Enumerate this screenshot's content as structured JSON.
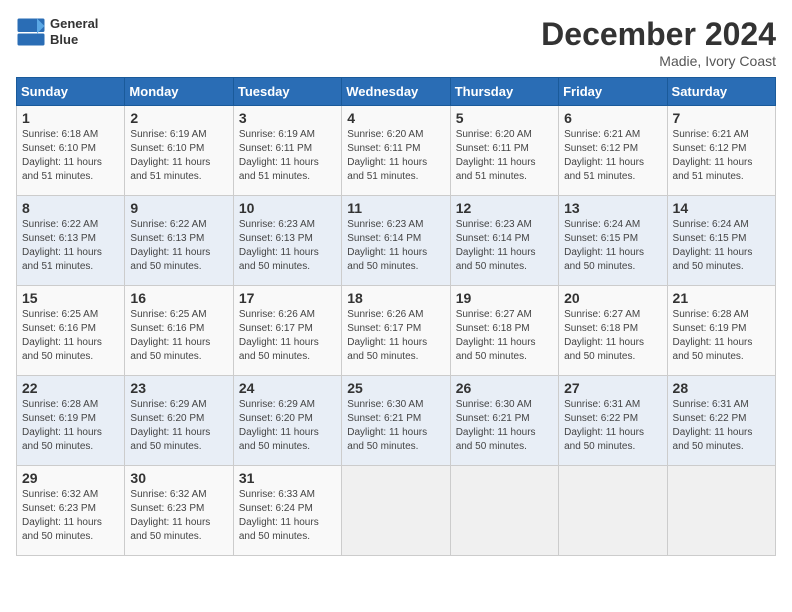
{
  "logo": {
    "line1": "General",
    "line2": "Blue"
  },
  "title": "December 2024",
  "subtitle": "Madie, Ivory Coast",
  "weekdays": [
    "Sunday",
    "Monday",
    "Tuesday",
    "Wednesday",
    "Thursday",
    "Friday",
    "Saturday"
  ],
  "weeks": [
    [
      {
        "day": "1",
        "sunrise": "6:18 AM",
        "sunset": "6:10 PM",
        "daylight": "11 hours and 51 minutes."
      },
      {
        "day": "2",
        "sunrise": "6:19 AM",
        "sunset": "6:10 PM",
        "daylight": "11 hours and 51 minutes."
      },
      {
        "day": "3",
        "sunrise": "6:19 AM",
        "sunset": "6:11 PM",
        "daylight": "11 hours and 51 minutes."
      },
      {
        "day": "4",
        "sunrise": "6:20 AM",
        "sunset": "6:11 PM",
        "daylight": "11 hours and 51 minutes."
      },
      {
        "day": "5",
        "sunrise": "6:20 AM",
        "sunset": "6:11 PM",
        "daylight": "11 hours and 51 minutes."
      },
      {
        "day": "6",
        "sunrise": "6:21 AM",
        "sunset": "6:12 PM",
        "daylight": "11 hours and 51 minutes."
      },
      {
        "day": "7",
        "sunrise": "6:21 AM",
        "sunset": "6:12 PM",
        "daylight": "11 hours and 51 minutes."
      }
    ],
    [
      {
        "day": "8",
        "sunrise": "6:22 AM",
        "sunset": "6:13 PM",
        "daylight": "11 hours and 51 minutes."
      },
      {
        "day": "9",
        "sunrise": "6:22 AM",
        "sunset": "6:13 PM",
        "daylight": "11 hours and 50 minutes."
      },
      {
        "day": "10",
        "sunrise": "6:23 AM",
        "sunset": "6:13 PM",
        "daylight": "11 hours and 50 minutes."
      },
      {
        "day": "11",
        "sunrise": "6:23 AM",
        "sunset": "6:14 PM",
        "daylight": "11 hours and 50 minutes."
      },
      {
        "day": "12",
        "sunrise": "6:23 AM",
        "sunset": "6:14 PM",
        "daylight": "11 hours and 50 minutes."
      },
      {
        "day": "13",
        "sunrise": "6:24 AM",
        "sunset": "6:15 PM",
        "daylight": "11 hours and 50 minutes."
      },
      {
        "day": "14",
        "sunrise": "6:24 AM",
        "sunset": "6:15 PM",
        "daylight": "11 hours and 50 minutes."
      }
    ],
    [
      {
        "day": "15",
        "sunrise": "6:25 AM",
        "sunset": "6:16 PM",
        "daylight": "11 hours and 50 minutes."
      },
      {
        "day": "16",
        "sunrise": "6:25 AM",
        "sunset": "6:16 PM",
        "daylight": "11 hours and 50 minutes."
      },
      {
        "day": "17",
        "sunrise": "6:26 AM",
        "sunset": "6:17 PM",
        "daylight": "11 hours and 50 minutes."
      },
      {
        "day": "18",
        "sunrise": "6:26 AM",
        "sunset": "6:17 PM",
        "daylight": "11 hours and 50 minutes."
      },
      {
        "day": "19",
        "sunrise": "6:27 AM",
        "sunset": "6:18 PM",
        "daylight": "11 hours and 50 minutes."
      },
      {
        "day": "20",
        "sunrise": "6:27 AM",
        "sunset": "6:18 PM",
        "daylight": "11 hours and 50 minutes."
      },
      {
        "day": "21",
        "sunrise": "6:28 AM",
        "sunset": "6:19 PM",
        "daylight": "11 hours and 50 minutes."
      }
    ],
    [
      {
        "day": "22",
        "sunrise": "6:28 AM",
        "sunset": "6:19 PM",
        "daylight": "11 hours and 50 minutes."
      },
      {
        "day": "23",
        "sunrise": "6:29 AM",
        "sunset": "6:20 PM",
        "daylight": "11 hours and 50 minutes."
      },
      {
        "day": "24",
        "sunrise": "6:29 AM",
        "sunset": "6:20 PM",
        "daylight": "11 hours and 50 minutes."
      },
      {
        "day": "25",
        "sunrise": "6:30 AM",
        "sunset": "6:21 PM",
        "daylight": "11 hours and 50 minutes."
      },
      {
        "day": "26",
        "sunrise": "6:30 AM",
        "sunset": "6:21 PM",
        "daylight": "11 hours and 50 minutes."
      },
      {
        "day": "27",
        "sunrise": "6:31 AM",
        "sunset": "6:22 PM",
        "daylight": "11 hours and 50 minutes."
      },
      {
        "day": "28",
        "sunrise": "6:31 AM",
        "sunset": "6:22 PM",
        "daylight": "11 hours and 50 minutes."
      }
    ],
    [
      {
        "day": "29",
        "sunrise": "6:32 AM",
        "sunset": "6:23 PM",
        "daylight": "11 hours and 50 minutes."
      },
      {
        "day": "30",
        "sunrise": "6:32 AM",
        "sunset": "6:23 PM",
        "daylight": "11 hours and 50 minutes."
      },
      {
        "day": "31",
        "sunrise": "6:33 AM",
        "sunset": "6:24 PM",
        "daylight": "11 hours and 50 minutes."
      },
      null,
      null,
      null,
      null
    ]
  ]
}
